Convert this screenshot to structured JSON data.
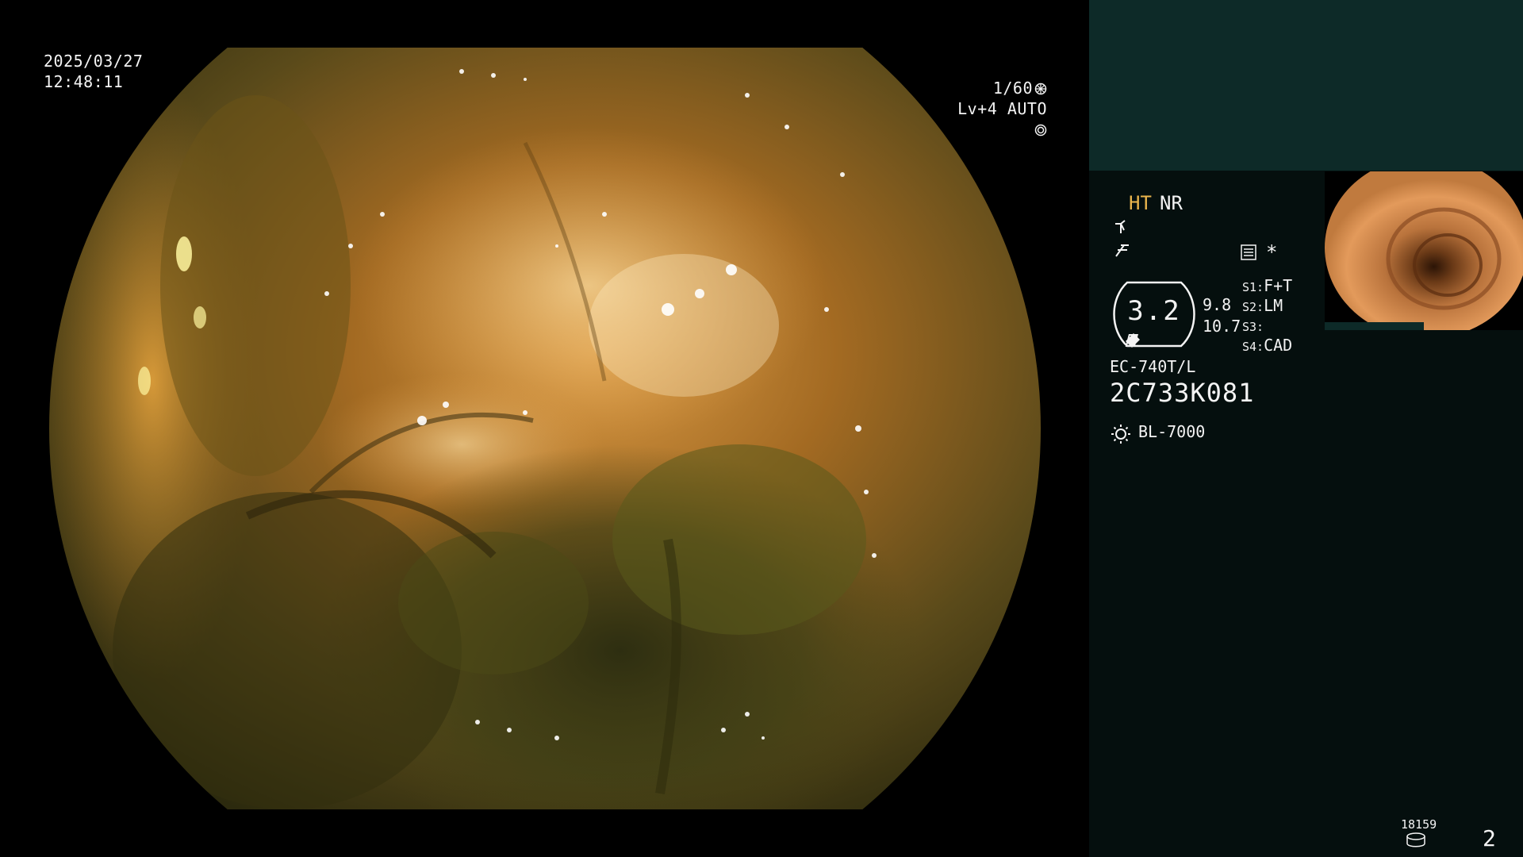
{
  "overlay": {
    "date": "2025/03/27",
    "time": "12:48:11",
    "shutter": "1/60",
    "level": "Lv+4 AUTO"
  },
  "panel": {
    "mode_ht": "HT",
    "mode_nr": "NR",
    "gauge_value": "3.2",
    "gauge_side_1": "9.8",
    "gauge_side_2": "10.7",
    "slots": [
      {
        "key": "S1:",
        "value": "F+T"
      },
      {
        "key": "S2:",
        "value": "LM"
      },
      {
        "key": "S3:",
        "value": ""
      },
      {
        "key": "S4:",
        "value": "CAD"
      }
    ],
    "scope_model": "EC-740T/L",
    "scope_serial": "2C733K081",
    "light_source": "BL-7000",
    "star": "*"
  },
  "footer": {
    "counter": "18159",
    "page": "2"
  },
  "colors": {
    "panel_top": "#0d2a28",
    "panel_bg": "#050f0e",
    "accent_ht": "#e9b44c"
  }
}
